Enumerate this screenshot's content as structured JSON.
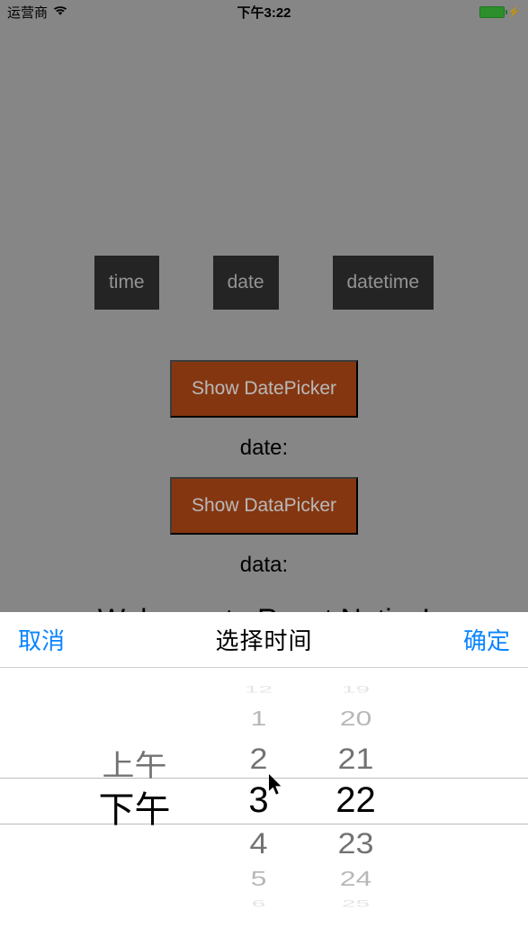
{
  "status": {
    "carrier": "运营商",
    "time": "下午3:22"
  },
  "modes": {
    "time": "time",
    "date": "date",
    "datetime": "datetime"
  },
  "buttons": {
    "show_date_picker": "Show DatePicker",
    "show_data_picker": "Show DataPicker"
  },
  "labels": {
    "date": "date:",
    "data": "data:",
    "welcome": "Welcome to React Native!"
  },
  "picker": {
    "cancel": "取消",
    "title": "选择时间",
    "confirm": "确定",
    "ampm": {
      "am": "上午",
      "pm": "下午",
      "selected": "下午"
    },
    "hours": {
      "minus3": "12",
      "minus2": "1",
      "minus1": "2",
      "selected": "3",
      "plus1": "4",
      "plus2": "5",
      "plus3": "6"
    },
    "minutes": {
      "minus3": "19",
      "minus2": "20",
      "minus1": "21",
      "selected": "22",
      "plus1": "23",
      "plus2": "24",
      "plus3": "25"
    }
  }
}
